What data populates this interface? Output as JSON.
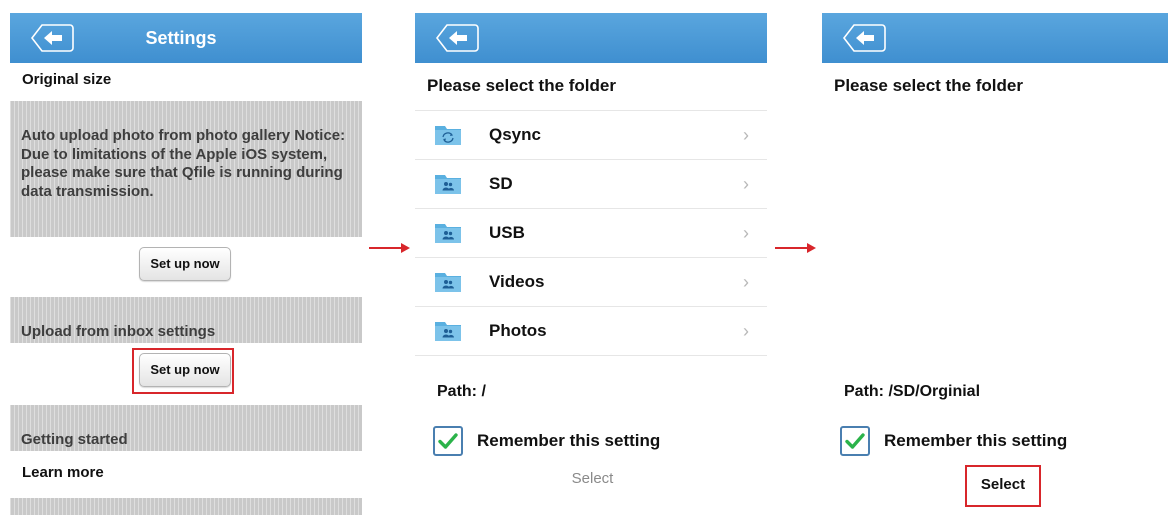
{
  "screen1": {
    "title": "Settings",
    "original_size": "Original size",
    "auto_upload_text": "Auto upload photo from photo gallery Notice: Due to limitations of the Apple iOS system, please make sure that Qfile is running during data transmission.",
    "setup_label_1": "Set up now",
    "inbox_label": "Upload from inbox settings",
    "setup_label_2": "Set up now",
    "getting_started": "Getting started",
    "learn_more": "Learn more"
  },
  "screen2": {
    "heading": "Please select the folder",
    "folders": [
      {
        "name": "Qsync",
        "icon": "sync-folder-icon"
      },
      {
        "name": "SD",
        "icon": "shared-folder-icon"
      },
      {
        "name": "USB",
        "icon": "shared-folder-icon"
      },
      {
        "name": "Videos",
        "icon": "shared-folder-icon"
      },
      {
        "name": "Photos",
        "icon": "shared-folder-icon"
      }
    ],
    "chevron": "›",
    "path": "Path: /",
    "remember_label": "Remember this setting",
    "remember_checked": true,
    "select_label": "Select"
  },
  "screen3": {
    "heading": "Please select the folder",
    "path": "Path: /SD/Orginial",
    "remember_label": "Remember this setting",
    "remember_checked": true,
    "select_label": "Select"
  },
  "colors": {
    "navbar": "#4a9ad6",
    "highlight": "#d8262b",
    "checkmark": "#2bb34a",
    "folder": "#5ab0e0"
  }
}
